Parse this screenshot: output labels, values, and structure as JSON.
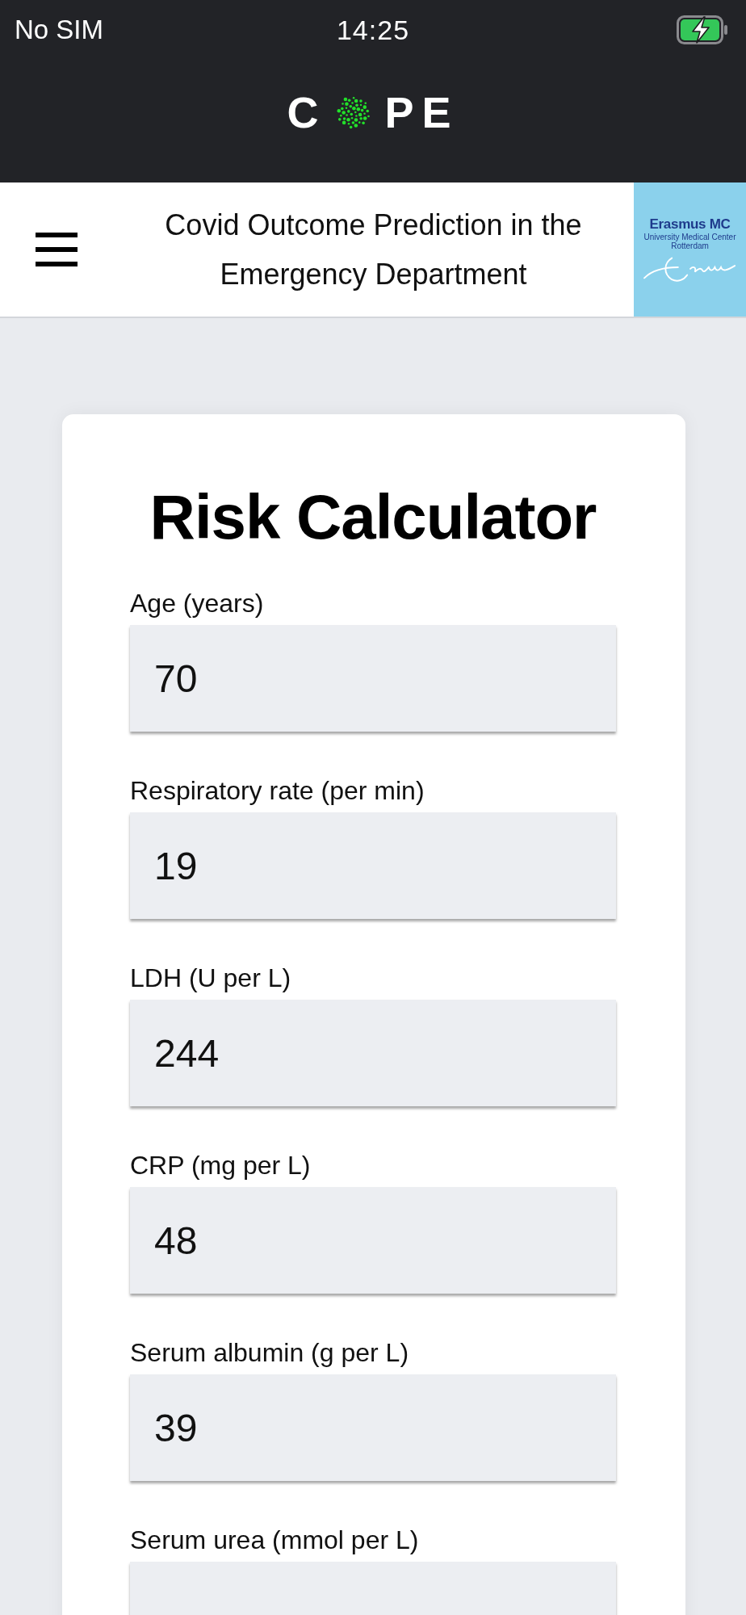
{
  "status_bar": {
    "carrier": "No SIM",
    "time": "14:25",
    "charging": true
  },
  "app_bar": {
    "logo": {
      "text_before": "C",
      "text_after": "PE"
    }
  },
  "header": {
    "title": "Covid Outcome Prediction in the Emergency Department",
    "partner_logo": {
      "name": "Erasmus MC",
      "subtitle": "University Medical Center Rotterdam"
    }
  },
  "card": {
    "title": "Risk Calculator",
    "fields": [
      {
        "label": "Age (years)",
        "value": "70"
      },
      {
        "label": "Respiratory rate (per min)",
        "value": "19"
      },
      {
        "label": "LDH (U per L)",
        "value": "244"
      },
      {
        "label": "CRP (mg per L)",
        "value": "48"
      },
      {
        "label": "Serum albumin (g per L)",
        "value": "39"
      },
      {
        "label": "Serum urea (mmol per L)"
      }
    ]
  }
}
